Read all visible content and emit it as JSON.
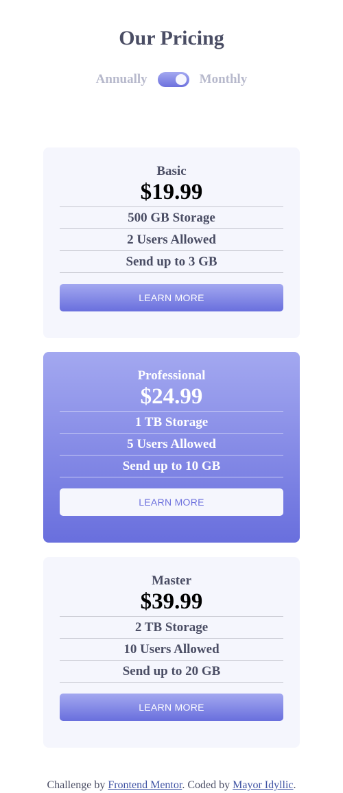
{
  "header": {
    "title": "Our Pricing",
    "toggle": {
      "left_label": "Annually",
      "right_label": "Monthly",
      "selected": "Monthly"
    }
  },
  "plans": [
    {
      "name": "Basic",
      "price": "$19.99",
      "features": [
        "500 GB Storage",
        "2 Users Allowed",
        "Send up to 3 GB"
      ],
      "button": "LEARN MORE"
    },
    {
      "name": "Professional",
      "price": "$24.99",
      "features": [
        "1 TB Storage",
        "5 Users Allowed",
        "Send up to 10 GB"
      ],
      "button": "LEARN MORE"
    },
    {
      "name": "Master",
      "price": "$39.99",
      "features": [
        "2 TB Storage",
        "10 Users Allowed",
        "Send up to 20 GB"
      ],
      "button": "LEARN MORE"
    }
  ],
  "footer": {
    "prefix": "Challenge by ",
    "link1": "Frontend Mentor",
    "middle": ". Coded by ",
    "link2": "Mayor Idyllic",
    "suffix": "."
  },
  "colors": {
    "accent_light": "#a3a8f0",
    "accent_dark": "#696fdd",
    "card_bg": "#f5f6fd",
    "text": "#4a4d64",
    "muted": "#b7b9cc"
  }
}
